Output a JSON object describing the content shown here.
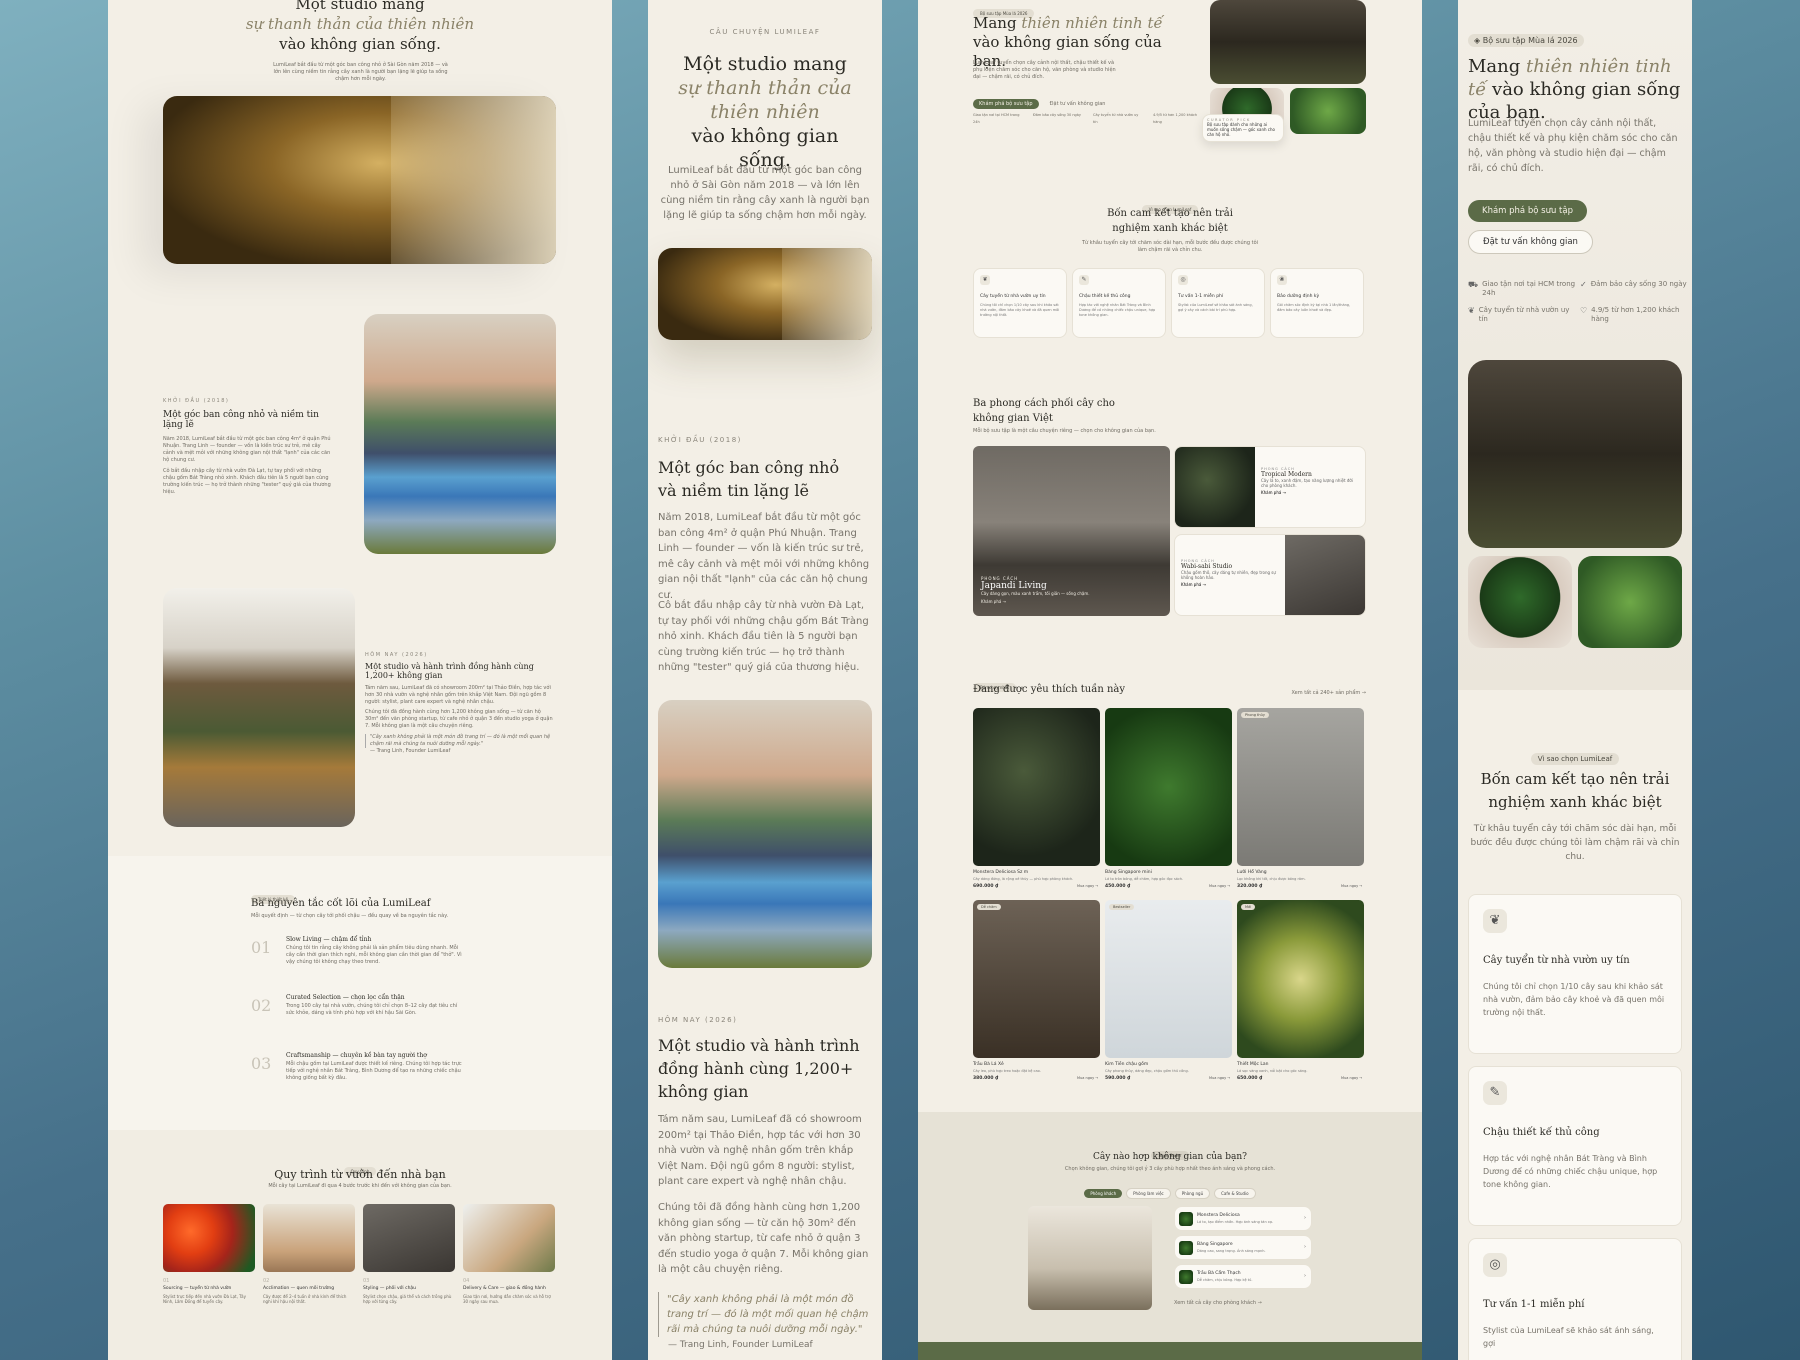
{
  "p1": {
    "hero_title_1": "Một studio mang",
    "hero_title_2": "sự thanh thản của thiên nhiên",
    "hero_title_3": "vào không gian sống.",
    "hero_sub": "LumiLeaf bắt đầu từ một góc ban công nhỏ ở Sài Gòn năm 2018 — và lớn lên cùng niềm tin rằng cây xanh là người bạn lặng lẽ giúp ta sống chậm hơn mỗi ngày.",
    "s1_eyebrow": "Khởi đầu (2018)",
    "s1_title": "Một góc ban công nhỏ và niềm tin lặng lẽ",
    "s1_p1": "Năm 2018, LumiLeaf bắt đầu từ một góc ban công 4m² ở quận Phú Nhuận. Trang Linh — founder — vốn là kiến trúc sư trẻ, mê cây cảnh và mệt mỏi với những không gian nội thất \"lạnh\" của các căn hộ chung cư.",
    "s1_p2": "Cô bắt đầu nhập cây từ nhà vườn Đà Lạt, tự tay phối với những chậu gốm Bát Tràng nhỏ xinh. Khách đầu tiên là 5 người bạn cùng trường kiến trúc — họ trở thành những \"tester\" quý giá của thương hiệu.",
    "s2_eyebrow": "Hôm nay (2026)",
    "s2_title": "Một studio và hành trình đồng hành cùng 1,200+ không gian",
    "s2_p1": "Tám năm sau, LumiLeaf đã có showroom 200m² tại Thảo Điền, hợp tác với hơn 30 nhà vườn và nghệ nhân gốm trên khắp Việt Nam. Đội ngũ gồm 8 người: stylist, plant care expert và nghệ nhân chậu.",
    "s2_p2": "Chúng tôi đã đồng hành cùng hơn 1,200 không gian sống — từ căn hộ 30m² đến văn phòng startup, từ cafe nhỏ ở quận 3 đến studio yoga ở quận 7. Mỗi không gian là một câu chuyện riêng.",
    "s2_quote": "\"Cây xanh không phải là một món đồ trang trí — đó là một mối quan hệ chậm rãi mà chúng ta nuôi dưỡng mỗi ngày.\"",
    "s2_cite": "— Trang Linh, Founder LumiLeaf",
    "principles_badge": "Triết lý thiết kế",
    "principles_title": "Ba nguyên tắc cốt lõi của LumiLeaf",
    "principles_sub": "Mỗi quyết định — từ chọn cây tới phối chậu — đều quay về ba nguyên tắc này.",
    "principles": [
      {
        "num": "01",
        "title": "Slow Living — chậm để tỉnh",
        "desc": "Chúng tôi tin rằng cây không phải là sản phẩm tiêu dùng nhanh. Mỗi cây cần thời gian thích nghi, mỗi không gian cần thời gian để \"thở\". Vì vậy chúng tôi không chạy theo trend."
      },
      {
        "num": "02",
        "title": "Curated Selection — chọn lọc cẩn thận",
        "desc": "Trong 100 cây tại nhà vườn, chúng tôi chỉ chọn 8–12 cây đạt tiêu chí sức khỏe, dáng và tính phù hợp với khí hậu Sài Gòn."
      },
      {
        "num": "03",
        "title": "Craftsmanship — chuyên kề bàn tay người thợ",
        "desc": "Mỗi chậu gốm tại LumiLeaf được thiết kế riêng. Chúng tôi hợp tác trực tiếp với nghệ nhân Bát Tràng, Bình Dương để tạo ra những chiếc chậu không giống bất kỳ đâu."
      }
    ],
    "process_badge": "Quy trình",
    "process_title": "Quy trình từ vườn đến nhà bạn",
    "process_sub": "Mỗi cây tại LumiLeaf đi qua 4 bước trước khi đến với không gian của bạn.",
    "process": [
      {
        "num": "01",
        "title": "Sourcing — tuyển từ nhà vườn",
        "desc": "Stylist trực tiếp đến nhà vườn Đà Lạt, Tây Ninh, Lâm Đồng để tuyển cây."
      },
      {
        "num": "02",
        "title": "Acclimation — quen môi trường",
        "desc": "Cây được để 2–4 tuần ở nhà kính để thích nghi khí hậu nội thất."
      },
      {
        "num": "03",
        "title": "Styling — phối với chậu",
        "desc": "Stylist chọn chậu, giá thể và cách trồng phù hợp với từng cây."
      },
      {
        "num": "04",
        "title": "Delivery & Care — giao & đồng hành",
        "desc": "Giao tận nơi, hướng dẫn chăm sóc và hỗ trợ 30 ngày sau mua."
      }
    ]
  },
  "p2": {
    "eyebrow": "Câu chuyện LumiLeaf",
    "title_1": "Một studio mang",
    "title_2": "sự thanh thản của thiên nhiên",
    "title_3": "vào không gian sống.",
    "sub": "LumiLeaf bắt đầu từ một góc ban công nhỏ ở Sài Gòn năm 2018 — và lớn lên cùng niềm tin rằng cây xanh là người bạn lặng lẽ giúp ta sống chậm hơn mỗi ngày.",
    "s1_eyebrow": "Khởi đầu (2018)",
    "s1_title": "Một góc ban công nhỏ và niềm tin lặng lẽ",
    "s1_p1": "Năm 2018, LumiLeaf bắt đầu từ một góc ban công 4m² ở quận Phú Nhuận. Trang Linh — founder — vốn là kiến trúc sư trẻ, mê cây cảnh và mệt mỏi với những không gian nội thất \"lạnh\" của các căn hộ chung cư.",
    "s1_p2": "Cô bắt đầu nhập cây từ nhà vườn Đà Lạt, tự tay phối với những chậu gốm Bát Tràng nhỏ xinh. Khách đầu tiên là 5 người bạn cùng trường kiến trúc — họ trở thành những \"tester\" quý giá của thương hiệu.",
    "s2_eyebrow": "Hôm nay (2026)",
    "s2_title": "Một studio và hành trình đồng hành cùng 1,200+ không gian",
    "s2_p1": "Tám năm sau, LumiLeaf đã có showroom 200m² tại Thảo Điền, hợp tác với hơn 30 nhà vườn và nghệ nhân gốm trên khắp Việt Nam. Đội ngũ gồm 8 người: stylist, plant care expert và nghệ nhân chậu.",
    "s2_p2": "Chúng tôi đã đồng hành cùng hơn 1,200 không gian sống — từ căn hộ 30m² đến văn phòng startup, từ cafe nhỏ ở quận 3 đến studio yoga ở quận 7. Mỗi không gian là một câu chuyện riêng.",
    "quote": "\"Cây xanh không phải là một món đồ trang trí — đó là một mối quan hệ chậm rãi mà chúng ta nuôi dưỡng mỗi ngày.\"",
    "cite": "— Trang Linh, Founder LumiLeaf"
  },
  "p3": {
    "badge": "Bộ sưu tập Mùa lá 2026",
    "hero_1": "Mang ",
    "hero_it": "thiên nhiên tinh tế",
    "hero_2": " vào không gian sống của bạn.",
    "hero_sub": "LumiLeaf tuyển chọn cây cảnh nội thất, chậu thiết kế và phụ kiện chăm sóc cho căn hộ, văn phòng và studio hiện đại — chậm rãi, có chủ đích.",
    "btn_primary": "Khám phá bộ sưu tập",
    "btn_secondary": "Đặt tư vấn không gian",
    "trust": [
      "Giao tận nơi tại HCM trong 24h",
      "Đảm bảo cây sống 30 ngày",
      "Cây tuyển từ nhà vườn uy tín",
      "4.9/5 từ hơn 1,200 khách hàng"
    ],
    "curator_label": "Curator pick",
    "curator_text": "Bộ sưu tập dành cho những ai muốn sống chậm — góc xanh cho căn hộ nhỏ.",
    "why_badge": "Vì sao chọn LumiLeaf",
    "why_title": "Bốn cam kết tạo nên trải nghiệm xanh khác biệt",
    "why_sub": "Từ khâu tuyển cây tới chăm sóc dài hạn, mỗi bước đều được chúng tôi làm chậm rãi và chỉn chu.",
    "why": [
      {
        "title": "Cây tuyển từ nhà vườn uy tín",
        "desc": "Chúng tôi chỉ chọn 1/10 cây sau khi khảo sát nhà vườn, đảm bảo cây khoẻ và đã quen môi trường nội thất."
      },
      {
        "title": "Chậu thiết kế thủ công",
        "desc": "Hợp tác với nghệ nhân Bát Tràng và Bình Dương để có những chiếc chậu unique, hợp tone không gian."
      },
      {
        "title": "Tư vấn 1-1 miễn phí",
        "desc": "Stylist của LumiLeaf sẽ khảo sát ánh sáng, gợi ý cây và cách bài trí phù hợp."
      },
      {
        "title": "Bảo dưỡng định kỳ",
        "desc": "Gói chăm sóc định kỳ tại nhà 1 lần/tháng, đảm bảo cây luôn khoẻ và đẹp."
      }
    ],
    "styles_title": "Ba phong cách phối cây cho không gian Việt",
    "styles_sub": "Mỗi bộ sưu tập là một câu chuyện riêng — chọn cho không gian của bạn.",
    "styles": [
      {
        "eyebrow": "Phong cách",
        "name": "Japandi Living",
        "desc": "Cây dáng gọn, màu xanh trầm, tối giản — sống chậm.",
        "link": "Khám phá →"
      },
      {
        "eyebrow": "Phong cách",
        "name": "Tropical Modern",
        "desc": "Cây lá to, xanh đậm, tạo năng lượng nhiệt đới cho phòng khách.",
        "link": "Khám phá →"
      },
      {
        "eyebrow": "Phong cách",
        "name": "Wabi-sabi Studio",
        "desc": "Chậu gốm thô, cây dáng tự nhiên, đẹp trong sự không hoàn hảo.",
        "link": "Khám phá →"
      }
    ],
    "fav_badge": "Bán chạy nhất",
    "fav_title": "Đang được yêu thích tuần này",
    "fav_link": "Xem tất cả 240+ sản phẩm →",
    "products": [
      {
        "badge": "",
        "name": "Monstera Deliciosa Sz m",
        "desc": "Cây dáng đứng, lá rộng xẻ thùy — phù hợp phòng khách.",
        "price": "690.000 ₫",
        "cta": "Mua ngay →"
      },
      {
        "badge": "",
        "name": "Bàng Singapore mini",
        "desc": "Lá to tròn bóng, dễ chăm, hợp góc đọc sách.",
        "price": "450.000 ₫",
        "cta": "Mua ngay →"
      },
      {
        "badge": "Phong thủy",
        "name": "Lưỡi Hổ Vàng",
        "desc": "Lọc không khí tốt, chịu được bóng râm.",
        "price": "320.000 ₫",
        "cta": "Mua ngay →"
      },
      {
        "badge": "Dễ chăm",
        "name": "Trầu Bà Lá Xẻ",
        "desc": "Cây leo, phù hợp treo hoặc đặt kệ cao.",
        "price": "380.000 ₫",
        "cta": "Mua ngay →"
      },
      {
        "badge": "Bestseller",
        "name": "Kim Tiền chậu gốm",
        "desc": "Cây phong thủy, dáng đẹp, chậu gốm thủ công.",
        "price": "590.000 ₫",
        "cta": "Mua ngay →"
      },
      {
        "badge": "Mới",
        "name": "Thiết Mộc Lan",
        "desc": "Lá sọc vàng xanh, nổi bật cho góc sáng.",
        "price": "650.000 ₫",
        "cta": "Mua ngay →"
      }
    ],
    "quiz_badge": "Style finder",
    "quiz_title": "Cây nào hợp không gian của bạn?",
    "quiz_sub": "Chọn không gian, chúng tôi gợi ý 3 cây phù hợp nhất theo ánh sáng và phong cách.",
    "quiz_tabs": [
      "Phòng khách",
      "Phòng làm việc",
      "Phòng ngủ",
      "Cafe & Studio"
    ],
    "quiz_items": [
      {
        "name": "Monstera Deliciosa",
        "desc": "Lá to, tạo điểm nhấn. Hợp ánh sáng tán xạ."
      },
      {
        "name": "Bàng Singapore",
        "desc": "Dáng cao, sang trọng. Ánh sáng mạnh."
      },
      {
        "name": "Trầu Bà Cẩm Thạch",
        "desc": "Dễ chăm, chịu bóng. Hợp kệ tủ."
      }
    ],
    "quiz_link": "Xem tất cả cây cho phòng khách →"
  },
  "p4": {
    "badge": "Bộ sưu tập Mùa lá 2026",
    "hero_1": "Mang ",
    "hero_it": "thiên nhiên tinh tế",
    "hero_2": " vào không gian sống của bạn.",
    "hero_sub": "LumiLeaf tuyển chọn cây cảnh nội thất, chậu thiết kế và phụ kiện chăm sóc cho căn hộ, văn phòng và studio hiện đại — chậm rãi, có chủ đích.",
    "btn_primary": "Khám phá bộ sưu tập",
    "btn_secondary": "Đặt tư vấn không gian",
    "trust": [
      "Giao tận nơi tại HCM trong 24h",
      "Đảm bảo cây sống 30 ngày",
      "Cây tuyển từ nhà vườn uy tín",
      "4.9/5 từ hơn 1,200 khách hàng"
    ],
    "why_badge": "Vì sao chọn LumiLeaf",
    "why_title": "Bốn cam kết tạo nên trải nghiệm xanh khác biệt",
    "why_sub": "Từ khâu tuyển cây tới chăm sóc dài hạn, mỗi bước đều được chúng tôi làm chậm rãi và chỉn chu.",
    "why": [
      {
        "title": "Cây tuyển từ nhà vườn uy tín",
        "desc": "Chúng tôi chỉ chọn 1/10 cây sau khi khảo sát nhà vườn, đảm bảo cây khoẻ và đã quen môi trường nội thất."
      },
      {
        "title": "Chậu thiết kế thủ công",
        "desc": "Hợp tác với nghệ nhân Bát Tràng và Bình Dương để có những chiếc chậu unique, hợp tone không gian."
      },
      {
        "title": "Tư vấn 1-1 miễn phí",
        "desc": "Stylist của LumiLeaf sẽ khảo sát ánh sáng, gợi"
      }
    ]
  }
}
